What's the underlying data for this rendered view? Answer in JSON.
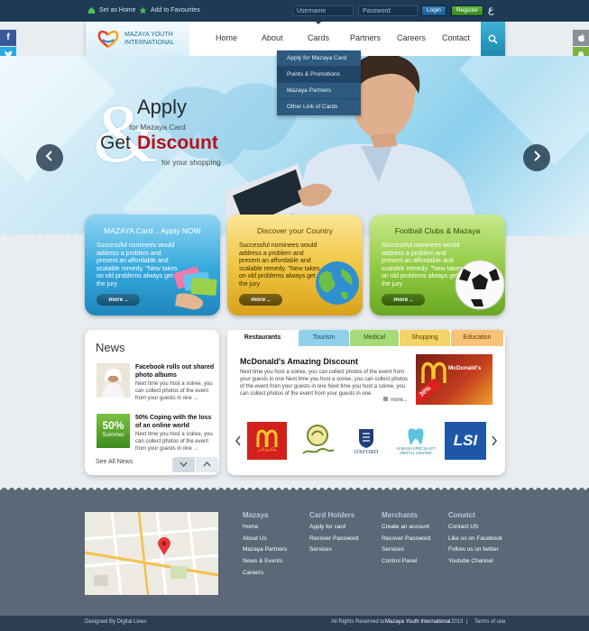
{
  "topbar": {
    "set_home": "Set as Home",
    "add_fav": "Add to Favourites",
    "username": "Username",
    "password": "Password",
    "login": "Login",
    "register": "Register",
    "lang": "ع"
  },
  "logo": {
    "line1": "MAZAYA YOUTH",
    "line2": "INTERNATIONAL"
  },
  "nav": [
    "Home",
    "About",
    "Cards",
    "Partners",
    "Careers",
    "Contact"
  ],
  "dropdown": [
    "Apply for Mazaya Card",
    "Points & Promotions",
    "Mazaya Partners",
    "Other Link of Cards"
  ],
  "hero": {
    "amp": "&",
    "apply": "Apply",
    "for_card": "for Mazaya Card",
    "get": "Get",
    "discount": "Discount",
    "shopping": "for your shopping"
  },
  "cards": [
    {
      "title": "MAZAYA Card .. Apply NOW",
      "text": "Successful nominees would address a problem and present an affordable and scalable remedy. \"New takes on old problems always get the jury",
      "button": "more .."
    },
    {
      "title": "Discover your Country",
      "text": "Successful nominees would address a problem and present an affordable and scalable remedy. \"New takes on old problems always get the jury",
      "button": "more .."
    },
    {
      "title": "Football Clubs & Mazaya",
      "text": "Successful nominees would address a problem and present an affordable and scalable remedy. \"New takes on old problems always get the jury",
      "button": "more .."
    }
  ],
  "news": {
    "title": "News",
    "items": [
      {
        "title": "Facebook rolls out shared photo albums",
        "text": "Next time you host a soiree, you can collect photos of the event from your guests in one ..."
      },
      {
        "title": "50% Coping with the loss of an online world",
        "text": "Next time you host a soiree, you can collect photos of the event from your guests in one ..."
      }
    ],
    "badge_big": "50%",
    "badge_small": "Summer",
    "see_all": "See All News"
  },
  "tabs": {
    "labels": [
      "Restaurants",
      "Tourism",
      "Medical",
      "Shopping",
      "Education"
    ],
    "heading": "McDonald's Amazing Discount",
    "text": "Next time you host a soiree, you can collect photos of the event from your guests in one Next time you host a soiree, you can collect photos of the event from your guests in one Next time you host a soiree, you can collect photos of the event from your guests in one",
    "more": "more...",
    "promo_label": "McDonald's",
    "promo_badge": "30%",
    "brands": [
      "ماكدونالدز",
      "",
      "OXFORD",
      "ALMASA SPECIALIST DENTAL CENTER",
      "LSI"
    ]
  },
  "footer": {
    "columns": [
      {
        "title": "Mazaya",
        "links": [
          "Home",
          "About Us",
          "Mazaya Partners",
          "News & Events",
          "Careers"
        ]
      },
      {
        "title": "Card Holders",
        "links": [
          "Apply for card",
          "Recover Password",
          "Services"
        ]
      },
      {
        "title": "Merchants",
        "links": [
          "Create an account",
          "Recover Password",
          "Services",
          "Control Panel"
        ]
      },
      {
        "title": "Conatct",
        "links": [
          "Contact US",
          "Like us on Facebook",
          "Follow us on twitter",
          "Youtube Channel"
        ]
      }
    ],
    "designed_by": "Designed By Digital Lines",
    "rights": "All Rights Reserved to",
    "brand": "Mazaya Youth International",
    "year": "2013",
    "sep": "|",
    "terms": "Terms of use"
  },
  "colors": {
    "accent": "#1d88ad",
    "dark_bar": "#1e3a55",
    "discount_red": "#b5121b"
  }
}
